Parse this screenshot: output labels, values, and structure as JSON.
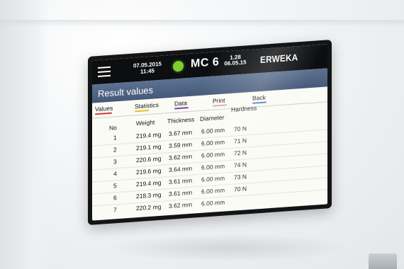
{
  "status_bar": {
    "date": "07.05.2015",
    "time": "11:45",
    "model": "MC 6",
    "version": "1.28",
    "version_date": "06.05.15",
    "brand": "ERWEKA",
    "led_color": "#7bd02e"
  },
  "title": "Result values",
  "tabs": [
    {
      "label": "Values",
      "underline_color": "#d83a2e"
    },
    {
      "label": "Statistics",
      "underline_color": "#e0c21e"
    },
    {
      "label": "Data",
      "underline_color": "#7a3fb0"
    },
    {
      "label": "Print",
      "underline_color": "#e6a0b8"
    },
    {
      "label": "Back",
      "underline_color": "#3f7fd0"
    }
  ],
  "table": {
    "headers": [
      "No",
      "Weight",
      "Thickness",
      "Diameter",
      "Hardness"
    ],
    "rows": [
      [
        "1",
        "219.4 mg",
        "3.67 mm",
        "6.00 mm",
        "70 N"
      ],
      [
        "2",
        "219.1 mg",
        "3.59 mm",
        "6.00 mm",
        "71 N"
      ],
      [
        "3",
        "220.6 mg",
        "3.62 mm",
        "6.00 mm",
        "72 N"
      ],
      [
        "4",
        "219.6 mg",
        "3.64 mm",
        "6.00 mm",
        "74 N"
      ],
      [
        "5",
        "219.4 mg",
        "3.61 mm",
        "6.00 mm",
        "73 N"
      ],
      [
        "6",
        "218.3 mg",
        "3.61 mm",
        "6.00 mm",
        "70 N"
      ],
      [
        "7",
        "220.2 mg",
        "3.62 mm",
        "6.00 mm",
        ""
      ]
    ]
  }
}
